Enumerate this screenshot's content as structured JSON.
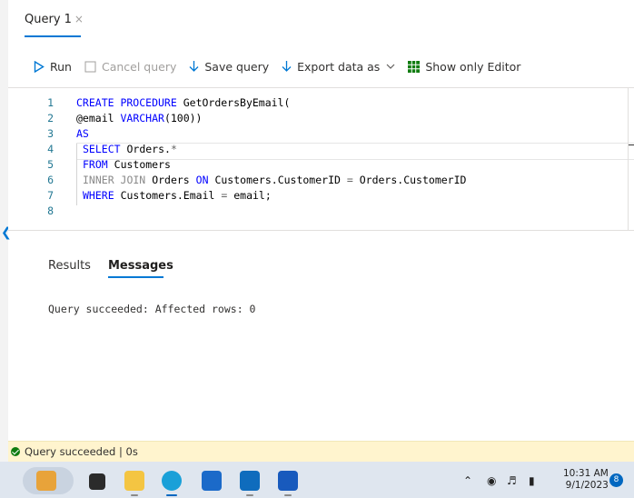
{
  "tab": {
    "title": "Query 1",
    "close_glyph": "×"
  },
  "toolbar": {
    "run_label": "Run",
    "cancel_label": "Cancel query",
    "save_label": "Save query",
    "export_label": "Export data as",
    "show_editor_label": "Show only Editor"
  },
  "editor": {
    "lines": [
      {
        "num": "1",
        "tokens": [
          [
            "kw",
            "CREATE PROCEDURE"
          ],
          [
            "",
            "GetOrdersByEmail("
          ]
        ]
      },
      {
        "num": "2",
        "tokens": [
          [
            "",
            "@email "
          ],
          [
            "kw",
            "VARCHAR"
          ],
          [
            "",
            "(100))"
          ]
        ]
      },
      {
        "num": "3",
        "tokens": [
          [
            "kw",
            "AS"
          ]
        ]
      },
      {
        "num": "4",
        "indent": true,
        "tokens": [
          [
            "kw",
            "SELECT"
          ],
          [
            "",
            "Orders."
          ],
          [
            "op",
            "*"
          ]
        ]
      },
      {
        "num": "5",
        "indent": true,
        "tokens": [
          [
            "kw",
            "FROM"
          ],
          [
            "",
            "Customers"
          ]
        ]
      },
      {
        "num": "6",
        "indent": true,
        "tokens": [
          [
            "gray",
            "INNER JOIN"
          ],
          [
            "",
            "Orders "
          ],
          [
            "kw",
            "ON"
          ],
          [
            "",
            "Customers.CustomerID "
          ],
          [
            "op",
            "="
          ],
          [
            "",
            "Orders.CustomerID"
          ]
        ]
      },
      {
        "num": "7",
        "indent": true,
        "tokens": [
          [
            "kw",
            "WHERE"
          ],
          [
            "",
            "Customers.Email "
          ],
          [
            "op",
            "="
          ],
          [
            "",
            "email;"
          ]
        ]
      },
      {
        "num": "8",
        "tokens": []
      }
    ]
  },
  "results": {
    "results_tab": "Results",
    "messages_tab": "Messages",
    "message": "Query succeeded: Affected rows: 0"
  },
  "status": {
    "text": "Query succeeded | 0s"
  },
  "taskbar": {
    "time": "10:31 AM",
    "date": "9/1/2023",
    "notification_count": "8"
  },
  "colors": {
    "accent": "#0078d4",
    "status_bg": "#fff4ce",
    "success": "#107c10",
    "taskbar_bg": "#dfe6ef"
  }
}
